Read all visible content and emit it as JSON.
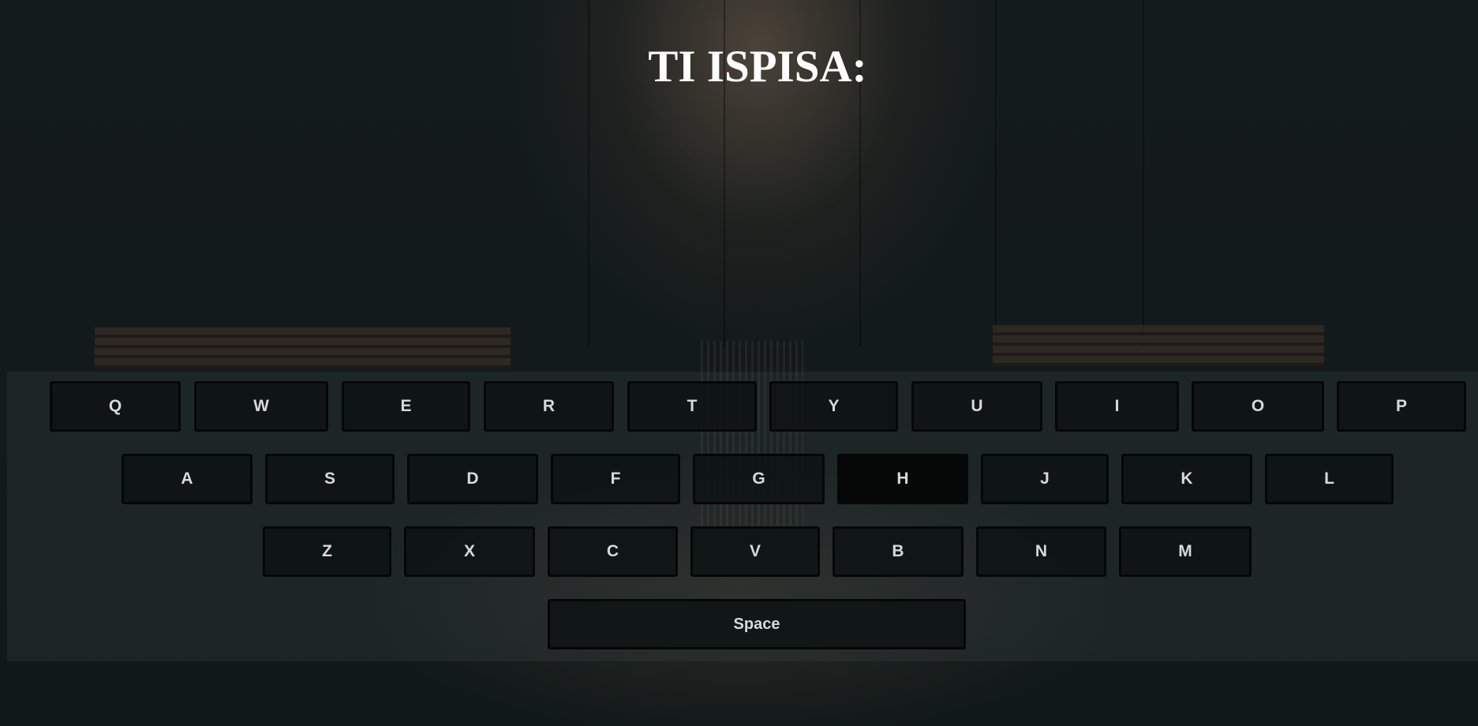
{
  "title": "TI ISPISA:",
  "keyboard": {
    "row1": [
      "Q",
      "W",
      "E",
      "R",
      "T",
      "Y",
      "U",
      "I",
      "O",
      "P"
    ],
    "row2": [
      "A",
      "S",
      "D",
      "F",
      "G",
      "H",
      "J",
      "K",
      "L"
    ],
    "row3": [
      "Z",
      "X",
      "C",
      "V",
      "B",
      "N",
      "M"
    ],
    "space_label": "Space",
    "highlighted_key": "H"
  }
}
